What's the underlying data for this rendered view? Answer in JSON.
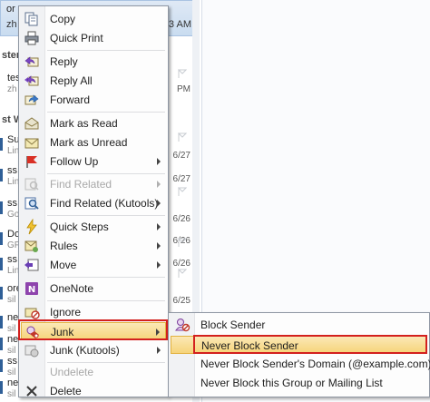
{
  "background": {
    "selected_row": {
      "line1": "or",
      "line2": "zh",
      "time": "3 AM"
    },
    "group_headers": [
      "ster",
      "st W"
    ],
    "rows": [
      {
        "line1": "tes",
        "line2": "zh",
        "date": "PM"
      },
      {
        "line1": "Su",
        "line2": "Lin",
        "date": "6/27"
      },
      {
        "line1": "ss",
        "line2": "Lin",
        "date": "6/27"
      },
      {
        "line1": "ss",
        "line2": "Go",
        "date": "6/26"
      },
      {
        "line1": "Do",
        "line2": "GF",
        "date": "6/26"
      },
      {
        "line1": "ss",
        "line2": "Lin",
        "date": "6/26"
      },
      {
        "line1": "ore",
        "line2": "sil",
        "date": "6/25"
      },
      {
        "line1": "ne",
        "line2": "sil",
        "date": ""
      },
      {
        "line1": "ne",
        "line2": "sil",
        "date": ""
      },
      {
        "line1": "ss",
        "line2": "sil",
        "date": ""
      },
      {
        "line1": "ne",
        "line2": "sil",
        "date": ""
      }
    ]
  },
  "menu": {
    "items": [
      {
        "label": "Copy",
        "icon": "copy-icon"
      },
      {
        "label": "Quick Print",
        "icon": "print-icon"
      },
      {
        "label": "Reply",
        "icon": "reply-icon"
      },
      {
        "label": "Reply All",
        "icon": "reply-all-icon"
      },
      {
        "label": "Forward",
        "icon": "forward-icon"
      },
      {
        "label": "Mark as Read",
        "icon": "envelope-open-icon"
      },
      {
        "label": "Mark as Unread",
        "icon": "envelope-closed-icon"
      },
      {
        "label": "Follow Up",
        "icon": "flag-icon"
      },
      {
        "label": "Find Related",
        "icon": "find-related-icon"
      },
      {
        "label": "Find Related (Kutools)",
        "icon": "find-related-kutools-icon"
      },
      {
        "label": "Quick Steps",
        "icon": "lightning-icon"
      },
      {
        "label": "Rules",
        "icon": "rules-icon"
      },
      {
        "label": "Move",
        "icon": "move-icon"
      },
      {
        "label": "OneNote",
        "icon": "onenote-icon"
      },
      {
        "label": "Ignore",
        "icon": "ignore-icon"
      },
      {
        "label": "Junk",
        "icon": "junk-icon"
      },
      {
        "label": "Junk (Kutools)",
        "icon": "junk-kutools-icon"
      },
      {
        "label": "Undelete",
        "icon": "undelete-icon"
      },
      {
        "label": "Delete",
        "icon": "delete-icon"
      }
    ]
  },
  "submenu": {
    "items": [
      {
        "label": "Block Sender",
        "icon": "block-sender-icon"
      },
      {
        "label": "Never Block Sender"
      },
      {
        "label": "Never Block Sender's Domain (@example.com)"
      },
      {
        "label": "Never Block this Group or Mailing List"
      }
    ]
  },
  "colors": {
    "highlight": "#f6d47a",
    "annotation": "#d3201e",
    "accent": "#2f5f97"
  }
}
